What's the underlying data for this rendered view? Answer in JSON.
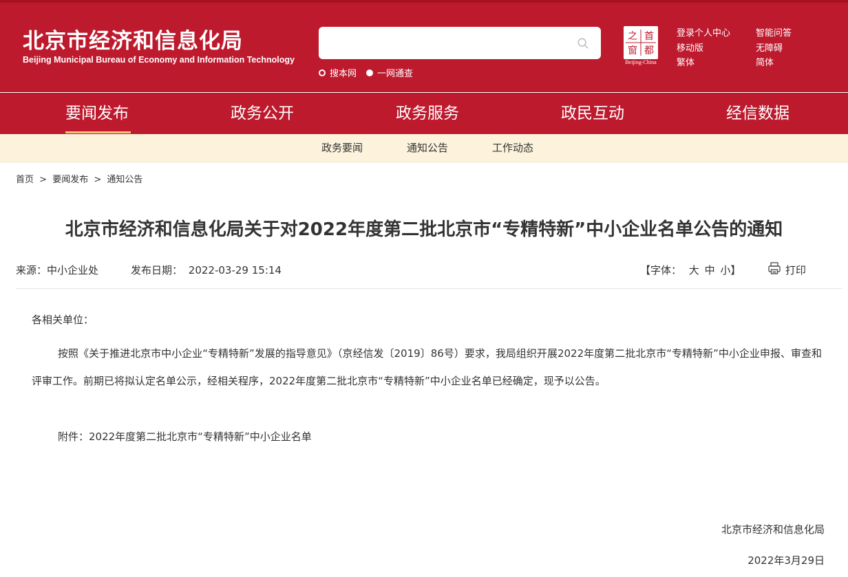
{
  "header": {
    "site_name": "北京市经济和信息化局",
    "site_name_en": "Beijing Municipal Bureau of Economy and Information Technology",
    "search": {
      "placeholder": ""
    },
    "search_options": [
      "搜本网",
      "一网通查"
    ],
    "logo": {
      "chars": [
        "之",
        "首",
        "窗",
        "都"
      ],
      "caption": "Beijing-China"
    },
    "links_left": [
      "登录个人中心",
      "移动版",
      "繁体"
    ],
    "links_right": [
      "智能问答",
      "无障碍",
      "简体"
    ]
  },
  "main_nav": [
    "要闻发布",
    "政务公开",
    "政务服务",
    "政民互动",
    "经信数据"
  ],
  "sub_nav": [
    "政务要闻",
    "通知公告",
    "工作动态"
  ],
  "breadcrumb": [
    "首页",
    "要闻发布",
    "通知公告"
  ],
  "breadcrumb_sep": ">",
  "article": {
    "title": "北京市经济和信息化局关于对2022年度第二批北京市“专精特新”中小企业名单公告的通知",
    "source_label": "来源：",
    "source": "中小企业处",
    "date_label": "发布日期：",
    "date": "2022-03-29 15:14",
    "font_label": "【字体：",
    "font_sizes": [
      "大",
      "中",
      "小"
    ],
    "font_close": "】",
    "print_label": "打印",
    "salutation": "各相关单位：",
    "body": "按照《关于推进北京市中小企业“专精特新”发展的指导意见》（京经信发〔2019〕86号）要求，我局组织开展2022年度第二批北京市“专精特新”中小企业申报、审查和评审工作。前期已将拟认定名单公示，经相关程序，2022年度第二批北京市“专精特新”中小企业名单已经确定，现予以公告。",
    "attachment": "附件：2022年度第二批北京市“专精特新”中小企业名单",
    "signature": "北京市经济和信息化局",
    "sign_date": "2022年3月29日"
  },
  "colors": {
    "brand_red": "#be1a2e",
    "sub_nav_bg": "#fdf3dc",
    "nav_underline": "#f4c27a"
  }
}
